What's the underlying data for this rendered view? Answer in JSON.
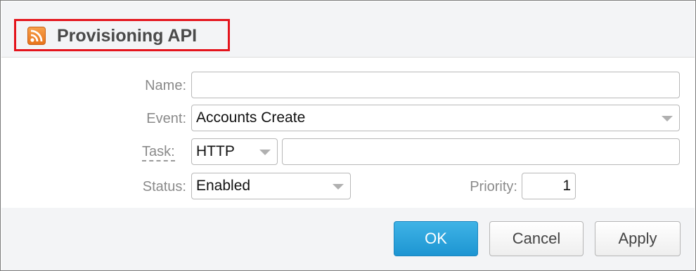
{
  "dialog": {
    "title": "Provisioning API",
    "title_icon": "rss-icon"
  },
  "form": {
    "name": {
      "label": "Name:",
      "value": ""
    },
    "event": {
      "label": "Event:",
      "value": "Accounts Create"
    },
    "task": {
      "label": "Task:",
      "type_value": "HTTP",
      "url_value": ""
    },
    "status": {
      "label": "Status:",
      "value": "Enabled"
    },
    "priority": {
      "label": "Priority:",
      "value": "1"
    }
  },
  "buttons": {
    "ok": "OK",
    "cancel": "Cancel",
    "apply": "Apply"
  },
  "colors": {
    "accent": "#1d95d2",
    "highlight": "#e4141c",
    "rss": "#e8731a"
  }
}
